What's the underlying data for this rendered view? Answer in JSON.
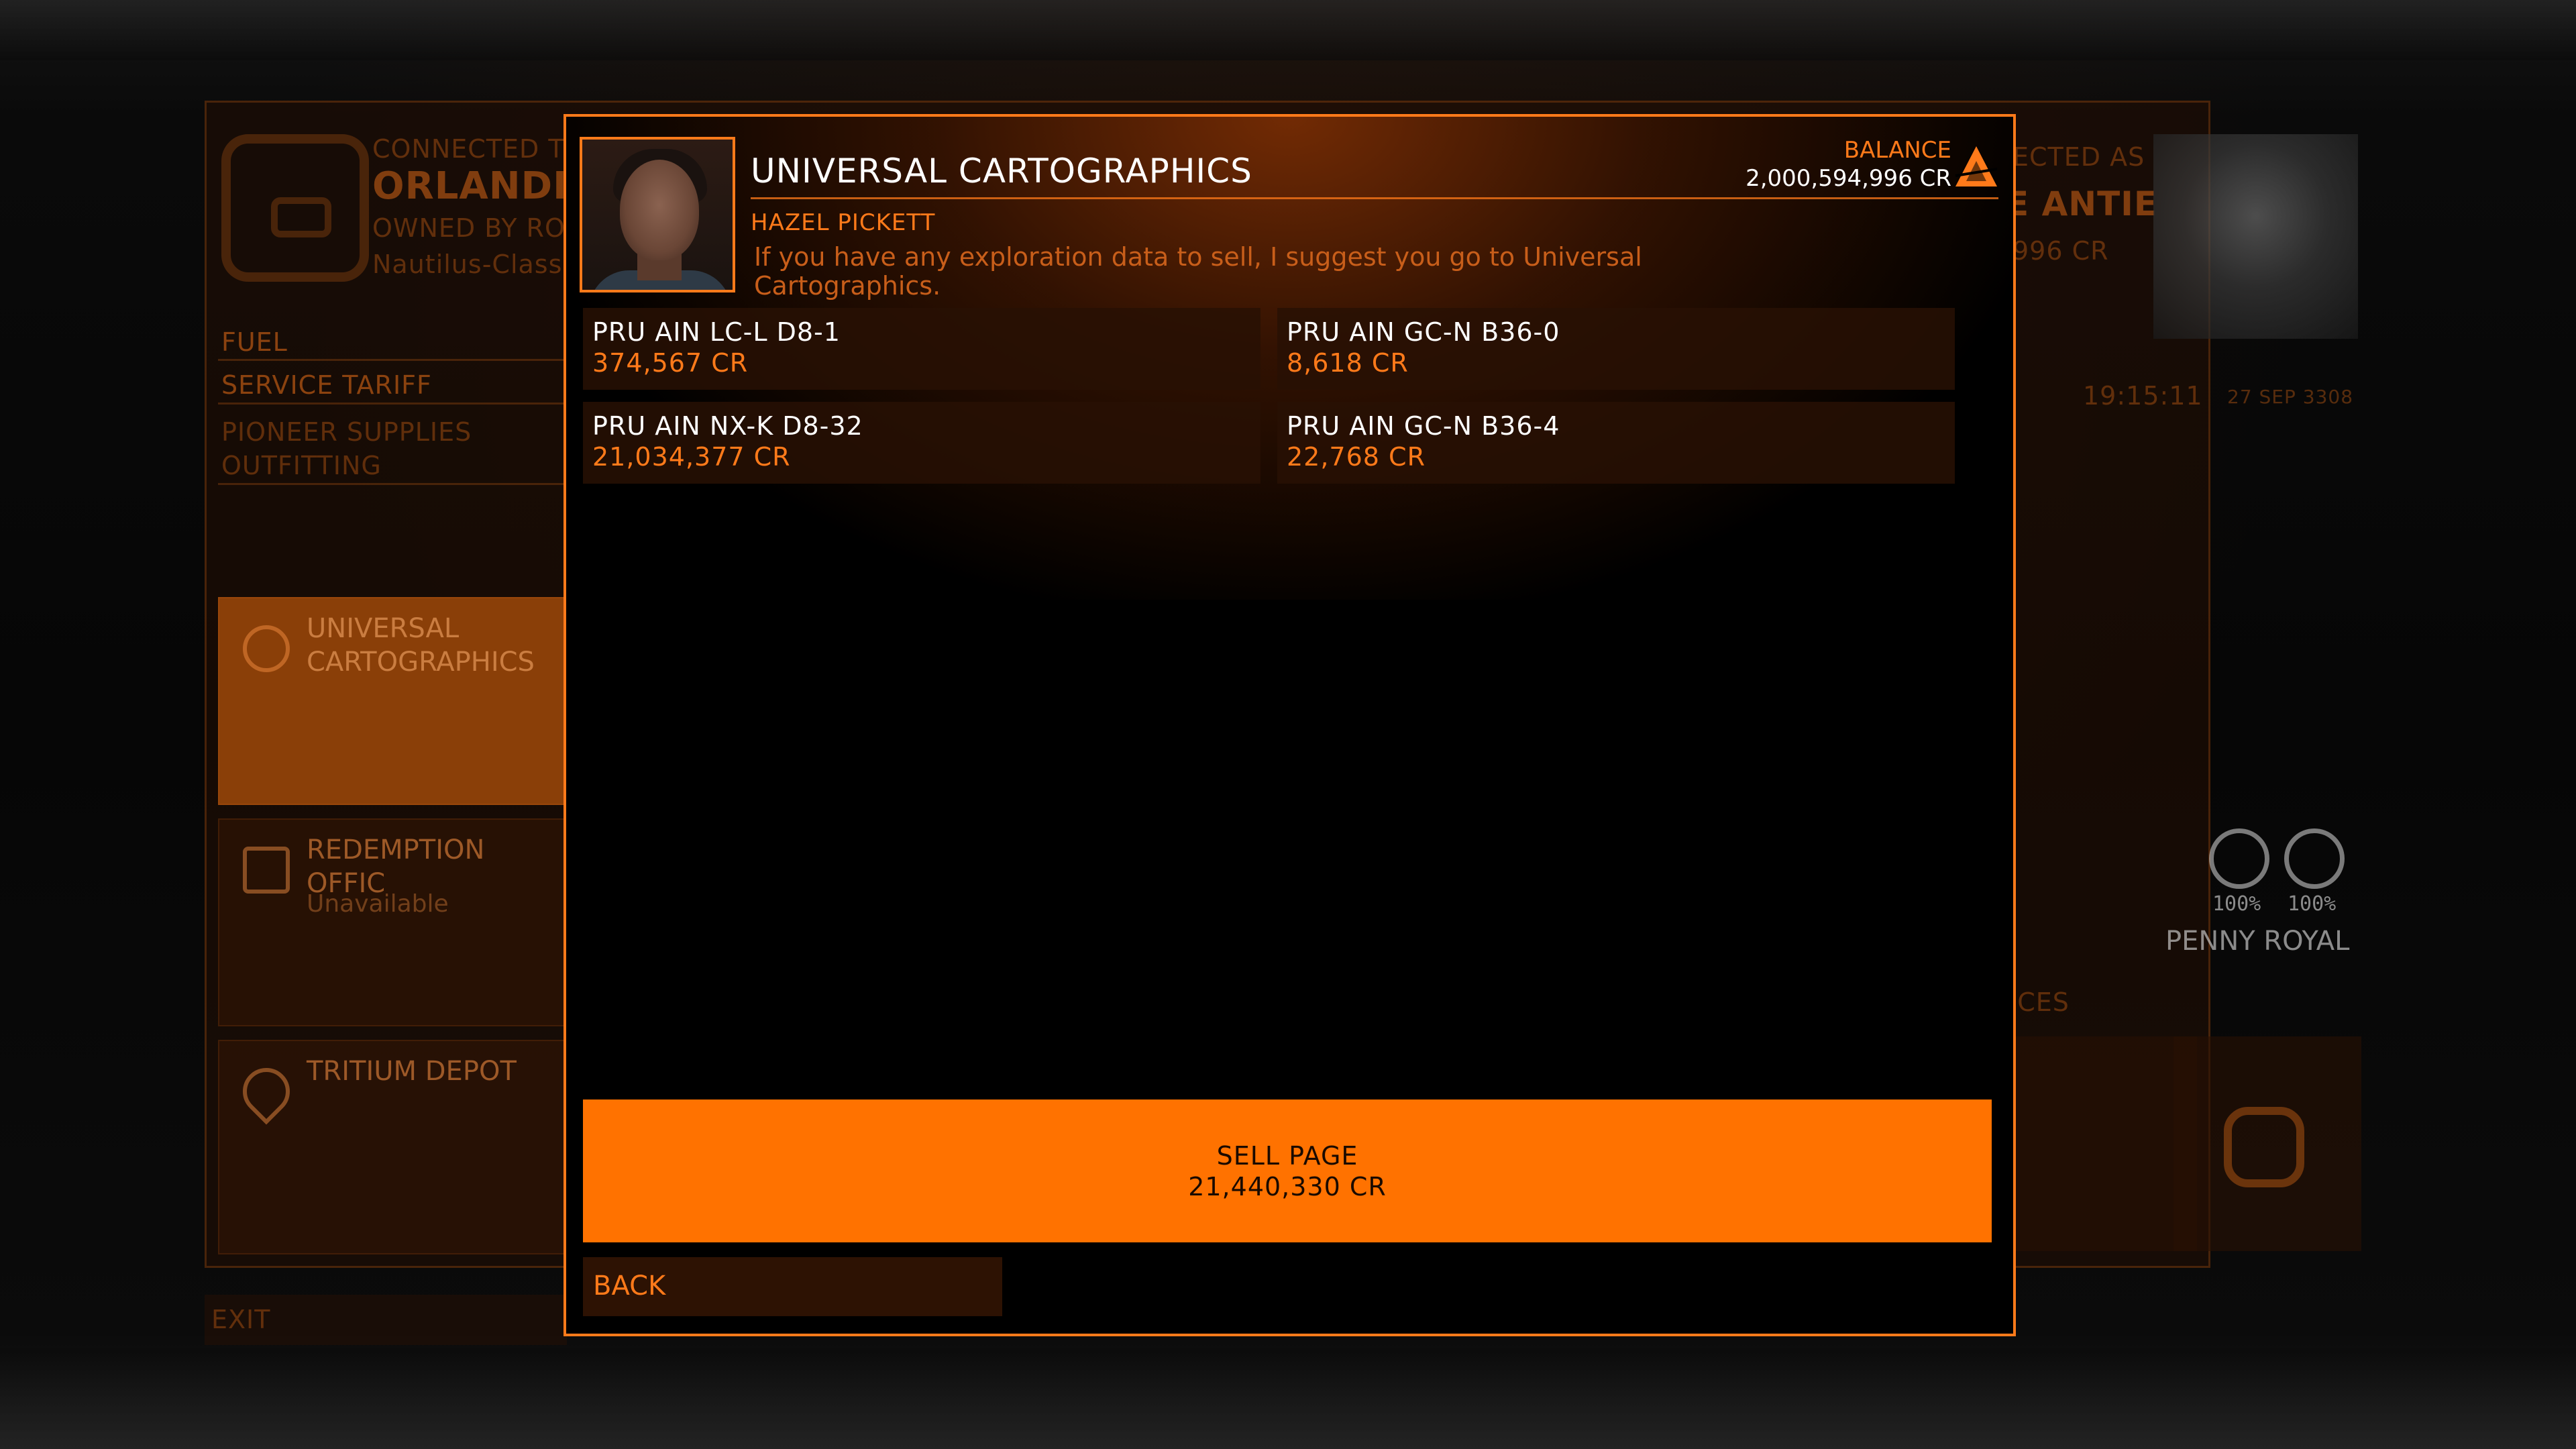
{
  "background": {
    "station": {
      "connected_to": "CONNECTED TO",
      "name": "ORLANDIN",
      "owned_by": "OWNED BY RO",
      "class": "Nautilus-Class"
    },
    "menu": [
      "FUEL",
      "SERVICE TARIFF",
      "PIONEER SUPPLIES",
      "OUTFITTING"
    ],
    "tiles": [
      {
        "label": "UNIVERSAL\nCARTOGRAPHICS",
        "sub": ""
      },
      {
        "label": "REDEMPTION OFFIC",
        "sub": "Unavailable"
      },
      {
        "label": "TRITIUM DEPOT",
        "sub": ""
      }
    ],
    "exit": "EXIT",
    "commander": {
      "connected_as": "ECTED AS",
      "name": "E ANTIE",
      "credits": "996 CR",
      "time": "19:15:11",
      "date": "27 SEP 3308"
    },
    "ship": {
      "fuel_pct": "100%",
      "hull_pct": "100%",
      "name": "PENNY ROYAL",
      "services_label": "ICES"
    }
  },
  "dialog": {
    "title": "UNIVERSAL CARTOGRAPHICS",
    "balance_label": "BALANCE",
    "balance_value": "2,000,594,996 CR",
    "npc_name": "HAZEL PICKETT",
    "npc_message": "If you have any exploration data to sell, I suggest you go to Universal Cartographics.",
    "data_items": [
      {
        "system": "PRU AIN LC-L D8-1",
        "value": "374,567 CR"
      },
      {
        "system": "PRU AIN GC-N B36-0",
        "value": "8,618 CR"
      },
      {
        "system": "PRU AIN NX-K D8-32",
        "value": "21,034,377 CR"
      },
      {
        "system": "PRU AIN GC-N B36-4",
        "value": "22,768 CR"
      }
    ],
    "sell_button": {
      "label": "SELL PAGE",
      "value": "21,440,330 CR"
    },
    "back_button": "BACK"
  },
  "colors": {
    "accent": "#ff7a1a",
    "button": "#ff7200",
    "text": "#ffffff"
  }
}
